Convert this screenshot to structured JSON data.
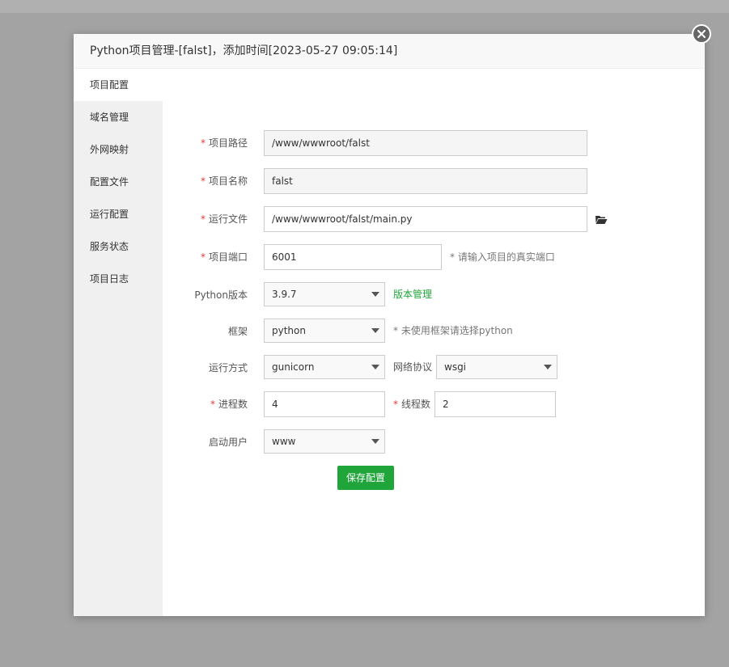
{
  "dialog": {
    "title": "Python项目管理-[falst]，添加时间[2023-05-27 09:05:14]"
  },
  "sidebar": {
    "items": [
      {
        "label": "项目配置",
        "active": true
      },
      {
        "label": "域名管理"
      },
      {
        "label": "外网映射"
      },
      {
        "label": "配置文件"
      },
      {
        "label": "运行配置"
      },
      {
        "label": "服务状态"
      },
      {
        "label": "项目日志"
      }
    ]
  },
  "form": {
    "required_mark": "*",
    "path": {
      "label": "项目路径",
      "value": "/www/wwwroot/falst"
    },
    "name": {
      "label": "项目名称",
      "value": "falst"
    },
    "run_file": {
      "label": "运行文件",
      "value": "/www/wwwroot/falst/main.py"
    },
    "port": {
      "label": "项目端口",
      "value": "6001",
      "hint": "* 请输入项目的真实端口"
    },
    "python_version": {
      "label": "Python版本",
      "value": "3.9.7",
      "link": "版本管理"
    },
    "framework": {
      "label": "框架",
      "value": "python",
      "hint": "* 未使用框架请选择python"
    },
    "run_mode": {
      "label": "运行方式",
      "value": "gunicorn"
    },
    "protocol": {
      "label": "网络协议",
      "value": "wsgi"
    },
    "processes": {
      "label": "进程数",
      "value": "4"
    },
    "threads": {
      "label": "线程数",
      "value": "2"
    },
    "user": {
      "label": "启动用户",
      "value": "www"
    },
    "save_label": "保存配置"
  },
  "colors": {
    "accent": "#20a53a",
    "required": "#e4393c",
    "overlay": "#a3a3a3"
  },
  "icons": {
    "close": "close-icon",
    "folder": "folder-open-icon",
    "dropdown": "chevron-down-icon"
  }
}
